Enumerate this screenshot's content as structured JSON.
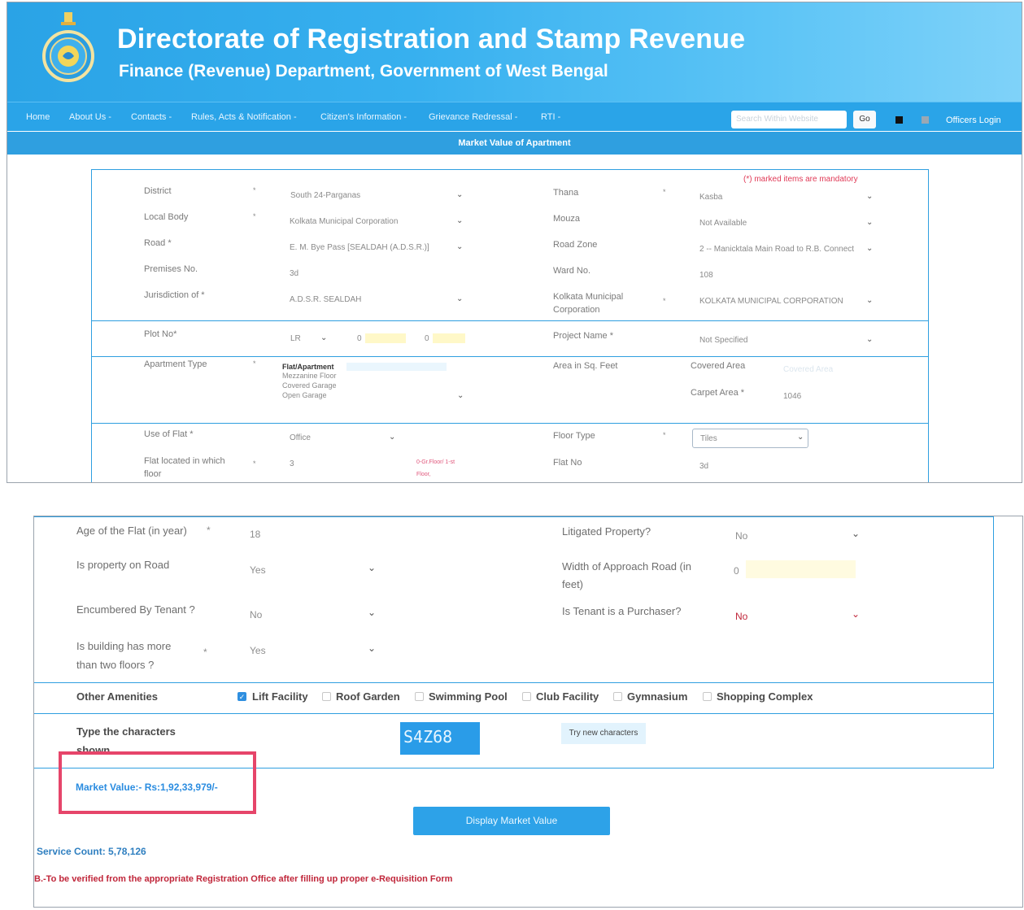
{
  "header": {
    "title": "Directorate of Registration and Stamp Revenue",
    "subtitle": "Finance (Revenue) Department, Government of West Bengal"
  },
  "nav": {
    "items": [
      "Home",
      "About Us -",
      "Contacts -",
      "Rules, Acts & Notification -",
      "Citizen's Information -",
      "Grievance Redressal -",
      "RTI -"
    ],
    "search_placeholder": "Search Within Website",
    "go_label": "Go",
    "officers_login": "Officers Login"
  },
  "page_title": "Market Value of Apartment",
  "form": {
    "mandatory_note": "(*) marked items are mandatory",
    "district_label": "District",
    "district_value": "South 24-Parganas",
    "thana_label": "Thana",
    "thana_value": "Kasba",
    "local_body_label": "Local Body",
    "local_body_value": "Kolkata Municipal Corporation",
    "mouza_label": "Mouza",
    "mouza_value": "Not Available",
    "road_label": "Road *",
    "road_value": "E. M. Bye Pass [SEALDAH (A.D.S.R.)]",
    "road_zone_label": "Road Zone",
    "road_zone_value": "2 -- Manicktala Main Road to R.B. Connect",
    "premises_label": "Premises No.",
    "premises_value": "3d",
    "ward_label": "Ward No.",
    "ward_value": "108",
    "jurisdiction_label": "Jurisdiction of *",
    "jurisdiction_value": "A.D.S.R. SEALDAH",
    "kmc_label_1": "Kolkata Municipal",
    "kmc_label_2": "Corporation",
    "kmc_value": "KOLKATA MUNICIPAL CORPORATION",
    "plot_label": "Plot No*",
    "plot_type": "LR",
    "plot_value_1": "0",
    "plot_value_2": "0",
    "project_label": "Project Name *",
    "project_value": "Not Specified",
    "apartment_type_label": "Apartment Type",
    "apartment_options": [
      "Flat/Apartment",
      "Mezzanine Floor",
      "Covered Garage",
      "Open Garage"
    ],
    "area_label": "Area in Sq. Feet",
    "covered_area_label": "Covered Area",
    "covered_area_placeholder": "Covered Area",
    "carpet_area_label": "Carpet Area *",
    "carpet_area_value": "1046",
    "use_label": "Use of Flat *",
    "use_value": "Office",
    "floor_type_label": "Floor Type",
    "floor_type_value": "Tiles",
    "flat_floor_label_1": "Flat located in which",
    "flat_floor_label_2": "floor",
    "flat_floor_value": "3",
    "flat_floor_hint_1": "0-Gr.Floor/ 1-st",
    "flat_floor_hint_2": "Floor,",
    "flat_no_label": "Flat No",
    "flat_no_value": "3d"
  },
  "form2": {
    "age_label": "Age of the Flat (in year)",
    "age_value": "18",
    "litigated_label": "Litigated Property?",
    "litigated_value": "No",
    "on_road_label": "Is property on Road",
    "on_road_value": "Yes",
    "approach_label_1": "Width of Approach Road (in",
    "approach_label_2": "feet)",
    "approach_value": "0",
    "tenant_label": "Encumbered By Tenant ?",
    "tenant_value": "No",
    "purchaser_label": "Is Tenant is a Purchaser?",
    "purchaser_value": "No",
    "floors_label_1": "Is building has more",
    "floors_label_2": "than two floors ?",
    "floors_value": "Yes",
    "amenities_label": "Other Amenities",
    "amenities": [
      "Lift Facility",
      "Roof Garden",
      "Swimming Pool",
      "Club Facility",
      "Gymnasium",
      "Shopping Complex"
    ],
    "captcha_label_1": "Type the characters",
    "captcha_label_2": "shown",
    "captcha_text": "S4Z68",
    "try_new": "Try new characters",
    "market_value": "Market Value:- Rs:1,92,33,979/-",
    "display_button": "Display Market Value",
    "service_count": "Service Count: 5,78,126",
    "nb_note": "N.B.-To be verified from the appropriate Registration Office after filling up proper e-Requisition Form"
  },
  "colors": {
    "header_blue": "#2aa3e6",
    "form_border": "#2f9fe0",
    "highlight_red": "#e6456a",
    "market_value_blue": "#2a8ce0",
    "nb_red": "#c0263a"
  }
}
